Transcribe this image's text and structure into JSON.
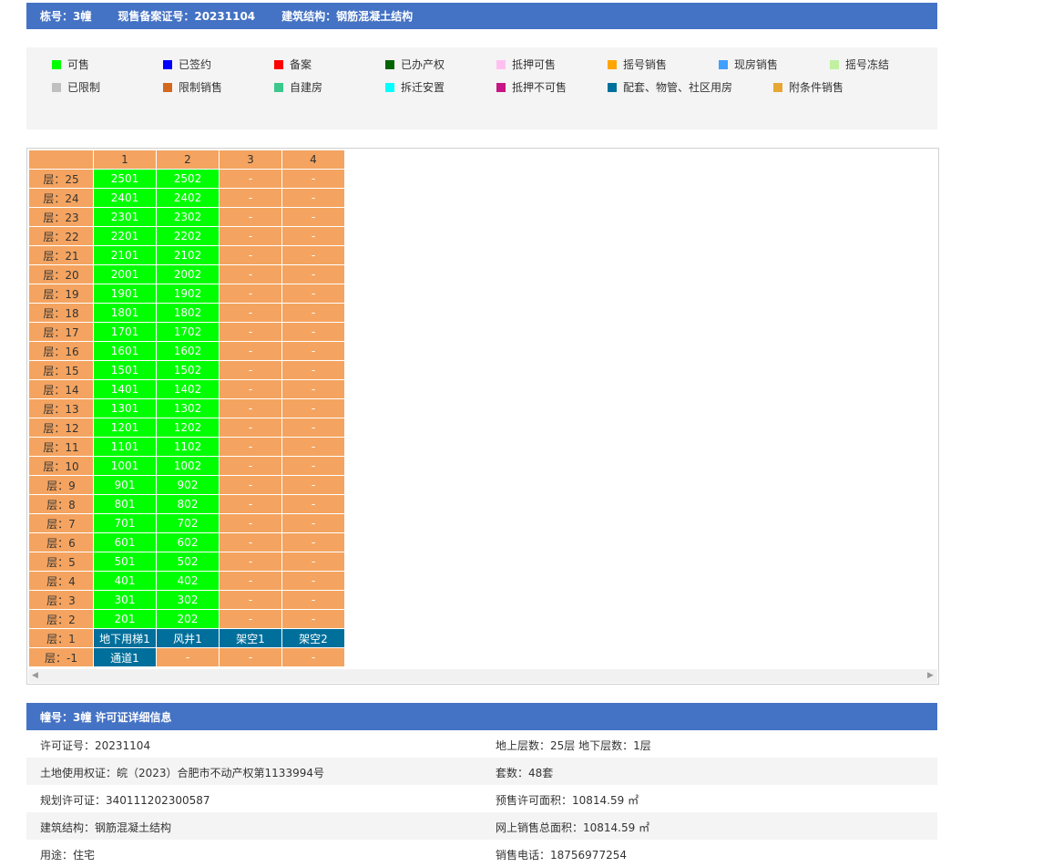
{
  "header": {
    "building": "栋号：3幢",
    "record": "现售备案证号：20231104",
    "structure": "建筑结构：钢筋混凝土结构"
  },
  "legend": [
    {
      "label": "可售",
      "color": "#00ff00"
    },
    {
      "label": "已签约",
      "color": "#0000ff"
    },
    {
      "label": "备案",
      "color": "#ff0000"
    },
    {
      "label": "已办产权",
      "color": "#006400"
    },
    {
      "label": "抵押可售",
      "color": "#ffc0f0"
    },
    {
      "label": "摇号销售",
      "color": "#ffa500"
    },
    {
      "label": "现房销售",
      "color": "#3fa0ff"
    },
    {
      "label": "摇号冻结",
      "color": "#c0f0a0"
    },
    {
      "label": "已限制",
      "color": "#c0c0c0"
    },
    {
      "label": "限制销售",
      "color": "#d2691e"
    },
    {
      "label": "自建房",
      "color": "#3cc88c"
    },
    {
      "label": "拆迁安置",
      "color": "#00ffff"
    },
    {
      "label": "抵押不可售",
      "color": "#c71585"
    },
    {
      "label": "配套、物管、社区用房",
      "color": "#006f9b"
    },
    {
      "label": "附条件销售",
      "color": "#e6a832"
    }
  ],
  "grid": {
    "columns": [
      "1",
      "2",
      "3",
      "4"
    ],
    "rows": [
      {
        "floor": "层：25",
        "units": [
          "2501",
          "2502",
          "-",
          "-"
        ]
      },
      {
        "floor": "层：24",
        "units": [
          "2401",
          "2402",
          "-",
          "-"
        ]
      },
      {
        "floor": "层：23",
        "units": [
          "2301",
          "2302",
          "-",
          "-"
        ]
      },
      {
        "floor": "层：22",
        "units": [
          "2201",
          "2202",
          "-",
          "-"
        ]
      },
      {
        "floor": "层：21",
        "units": [
          "2101",
          "2102",
          "-",
          "-"
        ]
      },
      {
        "floor": "层：20",
        "units": [
          "2001",
          "2002",
          "-",
          "-"
        ]
      },
      {
        "floor": "层：19",
        "units": [
          "1901",
          "1902",
          "-",
          "-"
        ]
      },
      {
        "floor": "层：18",
        "units": [
          "1801",
          "1802",
          "-",
          "-"
        ]
      },
      {
        "floor": "层：17",
        "units": [
          "1701",
          "1702",
          "-",
          "-"
        ]
      },
      {
        "floor": "层：16",
        "units": [
          "1601",
          "1602",
          "-",
          "-"
        ]
      },
      {
        "floor": "层：15",
        "units": [
          "1501",
          "1502",
          "-",
          "-"
        ]
      },
      {
        "floor": "层：14",
        "units": [
          "1401",
          "1402",
          "-",
          "-"
        ]
      },
      {
        "floor": "层：13",
        "units": [
          "1301",
          "1302",
          "-",
          "-"
        ]
      },
      {
        "floor": "层：12",
        "units": [
          "1201",
          "1202",
          "-",
          "-"
        ]
      },
      {
        "floor": "层：11",
        "units": [
          "1101",
          "1102",
          "-",
          "-"
        ]
      },
      {
        "floor": "层：10",
        "units": [
          "1001",
          "1002",
          "-",
          "-"
        ]
      },
      {
        "floor": "层：9",
        "units": [
          "901",
          "902",
          "-",
          "-"
        ]
      },
      {
        "floor": "层：8",
        "units": [
          "801",
          "802",
          "-",
          "-"
        ]
      },
      {
        "floor": "层：7",
        "units": [
          "701",
          "702",
          "-",
          "-"
        ]
      },
      {
        "floor": "层：6",
        "units": [
          "601",
          "602",
          "-",
          "-"
        ]
      },
      {
        "floor": "层：5",
        "units": [
          "501",
          "502",
          "-",
          "-"
        ]
      },
      {
        "floor": "层：4",
        "units": [
          "401",
          "402",
          "-",
          "-"
        ]
      },
      {
        "floor": "层：3",
        "units": [
          "301",
          "302",
          "-",
          "-"
        ]
      },
      {
        "floor": "层：2",
        "units": [
          "201",
          "202",
          "-",
          "-"
        ]
      },
      {
        "floor": "层：1",
        "units": [
          "地下用梯1",
          "风井1",
          "架空1",
          "架空2"
        ]
      },
      {
        "floor": "层：-1",
        "units": [
          "通道1",
          "-",
          "-",
          "-"
        ]
      }
    ]
  },
  "info": {
    "title": "幢号：3幢 许可证详细信息",
    "rows": [
      {
        "left": "许可证号：20231104",
        "right": "地上层数：25层  地下层数：1层"
      },
      {
        "left": "土地使用权证：皖（2023）合肥市不动产权第1133994号",
        "right": "套数：48套"
      },
      {
        "left": "规划许可证：340111202300587",
        "right": "预售许可面积：10814.59 ㎡"
      },
      {
        "left": "建筑结构：钢筋混凝土结构",
        "right": "网上销售总面积：10814.59 ㎡"
      },
      {
        "left": "用途：住宅",
        "right": "销售电话：18756977254"
      }
    ]
  }
}
